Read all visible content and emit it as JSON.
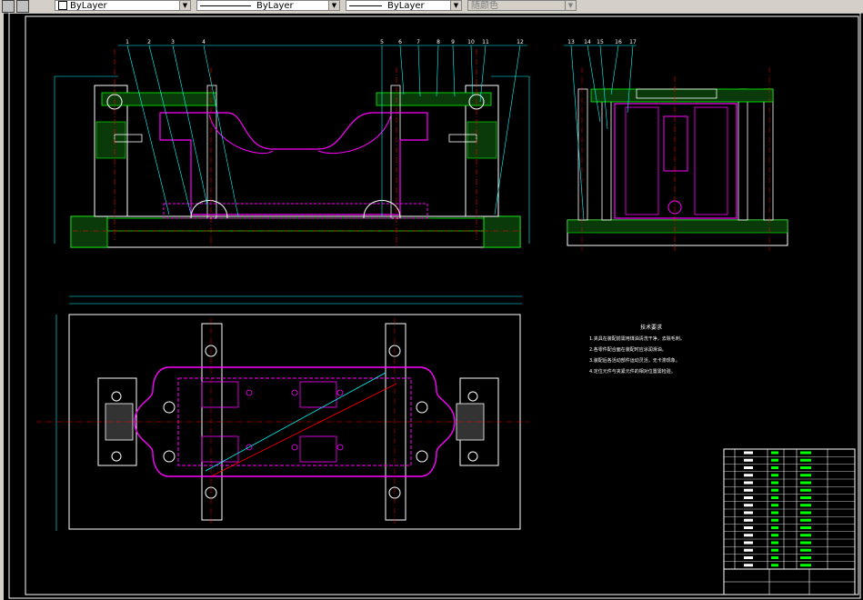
{
  "toolbar": {
    "color_value": "ByLayer",
    "linetype_value": "ByLayer",
    "lineweight_value": "ByLayer",
    "plotstyle_value": "随颜色"
  },
  "drawing": {
    "balloons_front": [
      "1",
      "2",
      "3",
      "4",
      "5",
      "6",
      "7",
      "8",
      "9",
      "10",
      "11",
      "12"
    ],
    "balloons_side": [
      "13",
      "14",
      "15",
      "16",
      "17"
    ],
    "tech_title": "技术要求",
    "tech_lines": [
      "1.夹具在装配前需用煤油清洗干净，去除毛刺。",
      "2.各零件配合面在装配时应涂润滑油。",
      "3.装配后各活动部件运动灵活，无卡滞现象。",
      "4.定位元件与夹紧元件的相对位置需检验。"
    ]
  },
  "colors": {
    "frame": "#ffffff",
    "part_outline": "#ff00ff",
    "fixture": "#00ff00",
    "center_line": "#ff0000",
    "dimension": "#00ffff",
    "hatch": "#00ff00"
  }
}
